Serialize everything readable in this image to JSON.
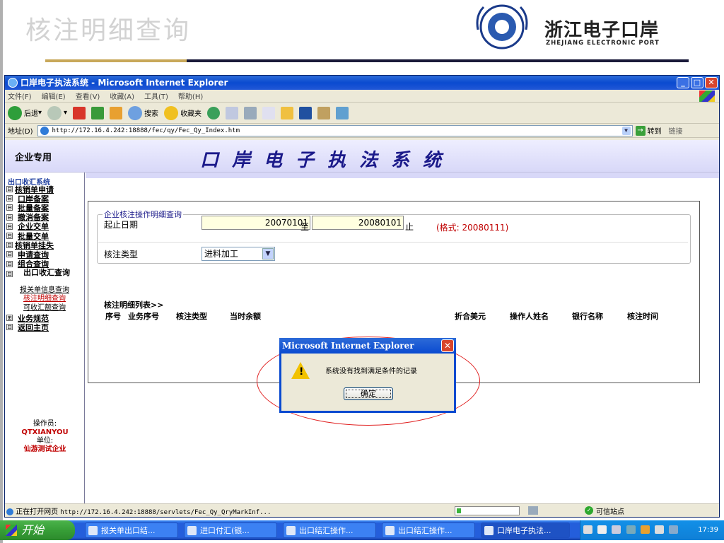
{
  "slide": {
    "title": "核注明细查询",
    "brand": "浙江电子口岸",
    "brand_sub": "ZHEJIANG ELECTRONIC PORT"
  },
  "window": {
    "title": "口岸电子执法系统 - Microsoft Internet Explorer",
    "menu": [
      "文件(F)",
      "编辑(E)",
      "查看(V)",
      "收藏(A)",
      "工具(T)",
      "帮助(H)"
    ],
    "toolbar": {
      "back": "后退",
      "search": "搜索",
      "favorites": "收藏夹"
    },
    "address_label": "地址(D)",
    "address": "http://172.16.4.242:18888/fec/qy/Fec_Qy_Index.htm",
    "go": "转到",
    "links": "链接"
  },
  "banner": {
    "enterprise": "企业专用",
    "system": "口岸电子执法系统"
  },
  "sidebar": {
    "header": "出口收汇系统",
    "items": [
      {
        "label": "核销单申请",
        "box": "⊟",
        "top": true
      },
      {
        "label": "口岸备案",
        "box": "⊟"
      },
      {
        "label": "批量备案",
        "box": "⊟"
      },
      {
        "label": "撤消备案",
        "box": "⊟"
      },
      {
        "label": "企业交单",
        "box": "⊟"
      },
      {
        "label": "批量交单",
        "box": "⊟"
      },
      {
        "label": "核销单挂失",
        "box": "⊟",
        "top": true
      },
      {
        "label": "申请查询",
        "box": "⊟"
      },
      {
        "label": "组合查询",
        "box": "⊟"
      }
    ],
    "group": "出口收汇查询",
    "subs": [
      {
        "label": "报关单信息查询",
        "active": false
      },
      {
        "label": "核注明细查询",
        "active": true
      },
      {
        "label": "可收汇额查询",
        "active": false
      }
    ],
    "bottom": [
      {
        "label": "业务规范",
        "box": "⊞"
      },
      {
        "label": "返回主页",
        "box": "⊟"
      }
    ],
    "operator_label": "操作员:",
    "operator": "QTXIANYOU",
    "unit_label": "单位:",
    "unit": "仙游测试企业"
  },
  "form": {
    "legend": "企业核注操作明细查询",
    "date_label": "起止日期",
    "start_date": "20070101",
    "to": "至",
    "end_date": "20080101",
    "stop": "止",
    "hint": "(格式: 20080111)",
    "type_label": "核注类型",
    "type_value": "进料加工"
  },
  "list": {
    "title": "核注明细列表>>",
    "columns": [
      "序号",
      "业务序号",
      "核注类型",
      "当时余额",
      "折合美元",
      "操作人姓名",
      "银行名称",
      "核注时间"
    ]
  },
  "dialog": {
    "title": "Microsoft Internet Explorer",
    "message": "系统没有找到满足条件的记录",
    "ok": "确定"
  },
  "status": {
    "text": "正在打开网页",
    "url": "http://172.16.4.242:18888/servlets/Fec_Qy_QryMarkInf...",
    "zone": "可信站点"
  },
  "taskbar": {
    "start": "开始",
    "tasks": [
      {
        "label": "报关单出口结...",
        "active": false
      },
      {
        "label": "进口付汇(银...",
        "active": false
      },
      {
        "label": "出口结汇操作...",
        "active": false
      },
      {
        "label": "出口结汇操作...",
        "active": false
      },
      {
        "label": "口岸电子执法...",
        "active": true
      }
    ],
    "clock": "17:39"
  }
}
